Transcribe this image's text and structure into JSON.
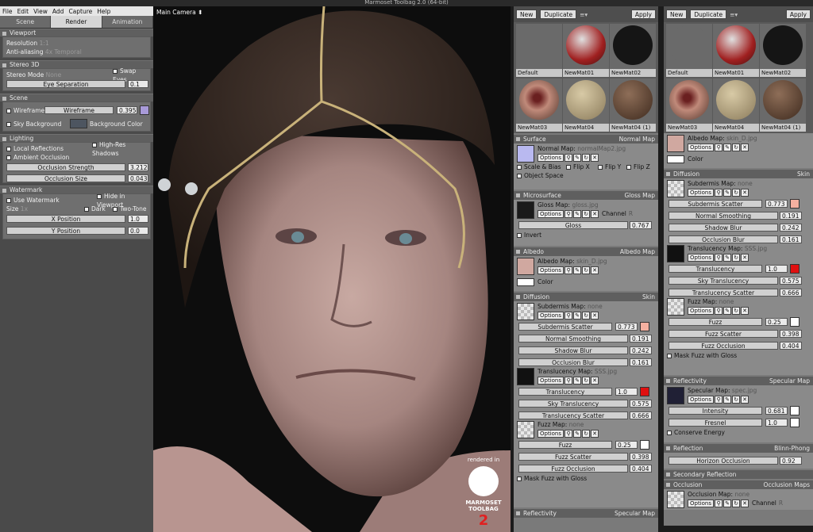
{
  "window_title": "Marmoset Toolbag 2.0 (64-bit)",
  "menu": [
    "File",
    "Edit",
    "View",
    "Add",
    "Capture",
    "Help"
  ],
  "left_tabs": [
    "Scene",
    "Render",
    "Animation"
  ],
  "viewport_panel": {
    "title": "Viewport",
    "resolution_label": "Resolution",
    "resolution_value": "1:1",
    "aa_label": "Anti-aliasing",
    "aa_value": "4x Temporal"
  },
  "stereo": {
    "title": "Stereo 3D",
    "mode_label": "Stereo Mode",
    "mode_value": "None",
    "swap": "Swap Eyes",
    "eye_sep": "Eye Separation",
    "eye_sep_value": "0.1"
  },
  "scene": {
    "title": "Scene",
    "wireframe": "Wireframe",
    "wireframe_slider": "Wireframe",
    "wireframe_value": "0.395",
    "wire_color": "#a89ad8",
    "sky_bg": "Sky Background",
    "bg_color_label": "Background Color",
    "bg_color": "#4d5560"
  },
  "lighting": {
    "title": "Lighting",
    "local_refl": "Local Reflections",
    "hires": "High-Res Shadows",
    "ao": "Ambient Occlusion",
    "occ_strength": "Occlusion Strength",
    "occ_strength_value": "3.212",
    "occ_size": "Occlusion Size",
    "occ_size_value": "0.043"
  },
  "watermark": {
    "title": "Watermark",
    "use": "Use Watermark",
    "hide": "Hide in Viewport",
    "size_label": "Size",
    "size_value": "1x",
    "dark": "Dark",
    "two_tone": "Two-Tone",
    "xpos": "X Position",
    "xpos_value": "1.0",
    "ypos": "Y Position",
    "ypos_value": "0.0"
  },
  "viewport": {
    "camera": "Main Camera",
    "logo_text": "rendered in",
    "logo_brand": "MARMOSET TOOLBAG",
    "logo_num": "2"
  },
  "matpanel": {
    "new": "New",
    "duplicate": "Duplicate",
    "apply": "Apply",
    "materials": [
      {
        "name": "Default",
        "color": "#6a6a6a"
      },
      {
        "name": "NewMat01",
        "color": "#a02020"
      },
      {
        "name": "NewMat02",
        "color": "#151515"
      },
      {
        "name": "NewMat03",
        "color": "#a5786a"
      },
      {
        "name": "NewMat04",
        "color": "#c4b48e"
      },
      {
        "name": "NewMat04 (1)",
        "color": "#6e5240"
      }
    ],
    "surface": {
      "title": "Surface",
      "mode": "Normal Map",
      "map_label": "Normal Map:",
      "map_file": "normalMap2.jpg",
      "options": "Options",
      "scale_bias": "Scale & Bias",
      "flipx": "Flip X",
      "flipy": "Flip Y",
      "flipz": "Flip Z",
      "object_space": "Object Space"
    },
    "micro": {
      "title": "Microsurface",
      "mode": "Gloss Map",
      "map_label": "Gloss Map:",
      "map_file": "gloss.jpg",
      "channel_label": "Channel",
      "channel_value": "R",
      "gloss": "Gloss",
      "gloss_value": "0.767",
      "invert": "Invert"
    },
    "albedo": {
      "title": "Albedo",
      "mode": "Albedo Map",
      "map_label": "Albedo Map:",
      "map_file": "skin_D.jpg",
      "color": "Color"
    },
    "diffusion": {
      "title": "Diffusion",
      "mode": "Skin",
      "sub_map": "Subdermis Map:",
      "sub_file": "none",
      "sub_scatter": "Subdermis Scatter",
      "sub_scatter_value": "0.773",
      "normal_smooth": "Normal Smoothing",
      "normal_smooth_value": "0.191",
      "shadow_blur": "Shadow Blur",
      "shadow_blur_value": "0.242",
      "occ_blur": "Occlusion Blur",
      "occ_blur_value": "0.161",
      "trans_map": "Translucency Map:",
      "trans_file": "SSS.jpg",
      "translucency": "Translucency",
      "translucency_value": "1.0",
      "sky_trans": "Sky Translucency",
      "sky_trans_value": "0.575",
      "trans_scatter": "Translucency Scatter",
      "trans_scatter_value": "0.666",
      "fuzz_map": "Fuzz Map:",
      "fuzz_file": "none",
      "fuzz": "Fuzz",
      "fuzz_value": "0.25",
      "fuzz_scatter": "Fuzz Scatter",
      "fuzz_scatter_value": "0.398",
      "fuzz_occ": "Fuzz Occlusion",
      "fuzz_occ_value": "0.404",
      "mask": "Mask Fuzz with Gloss",
      "sub_color": "#f4b0a0",
      "trans_color": "#e01010"
    },
    "reflectivity": {
      "title": "Reflectivity",
      "mode": "Specular Map",
      "spec_label": "Specular Map:",
      "spec_file": "spec.jpg",
      "intensity": "Intensity",
      "intensity_value": "0.681",
      "fresnel": "Fresnel",
      "fresnel_value": "1.0",
      "conserve": "Conserve Energy"
    },
    "reflection": {
      "title": "Reflection",
      "mode": "Blinn-Phong",
      "horizon": "Horizon Occlusion",
      "horizon_value": "0.92"
    },
    "secondary": {
      "title": "Secondary Reflection"
    },
    "occlusion": {
      "title": "Occlusion",
      "mode": "Occlusion Maps",
      "map_label": "Occlusion Map:",
      "map_file": "none",
      "channel_label": "Channel",
      "channel_value": "R"
    }
  }
}
